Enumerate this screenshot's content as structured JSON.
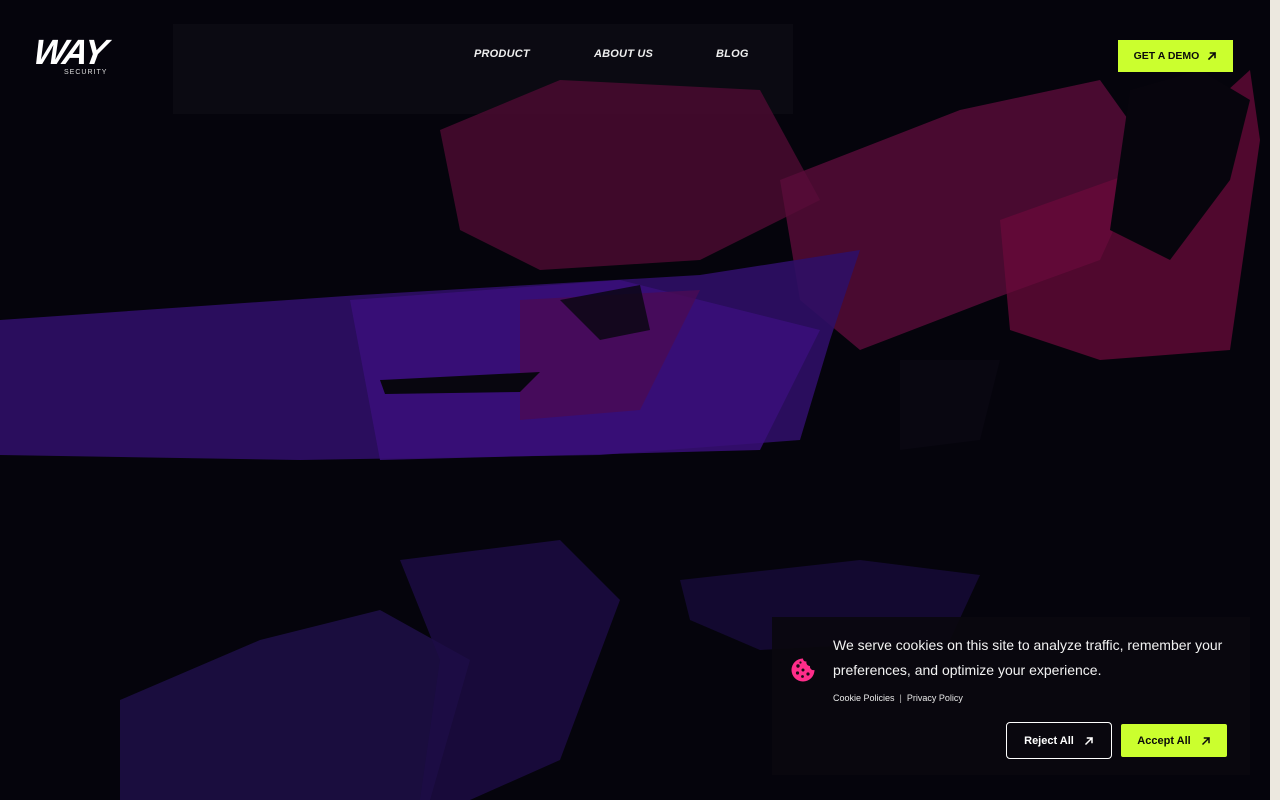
{
  "brand": {
    "logo_word": "WAY",
    "logo_sub": "SECURITY"
  },
  "nav": {
    "items": [
      {
        "label": "PRODUCT"
      },
      {
        "label": "ABOUT US"
      },
      {
        "label": "BLOG"
      }
    ],
    "cta_label": "GET A DEMO"
  },
  "cookie_banner": {
    "message": "We serve cookies on this site to analyze traffic, remember your preferences, and optimize your experience.",
    "links": [
      {
        "label": "Cookie Policies"
      },
      {
        "label": "Privacy Policy"
      }
    ],
    "separator": "|",
    "reject_label": "Reject All",
    "accept_label": "Accept All"
  },
  "icons": {
    "cta": "arrow-up-right-icon",
    "cookie": "cookie-icon"
  },
  "colors": {
    "accent": "#cbff2e",
    "background": "#05040c",
    "hero_purple": "#3a0f7a",
    "hero_magenta": "#6a0a3a",
    "cookie_icon": "#ff2d8a",
    "scrollbar_track": "#ece8df"
  }
}
